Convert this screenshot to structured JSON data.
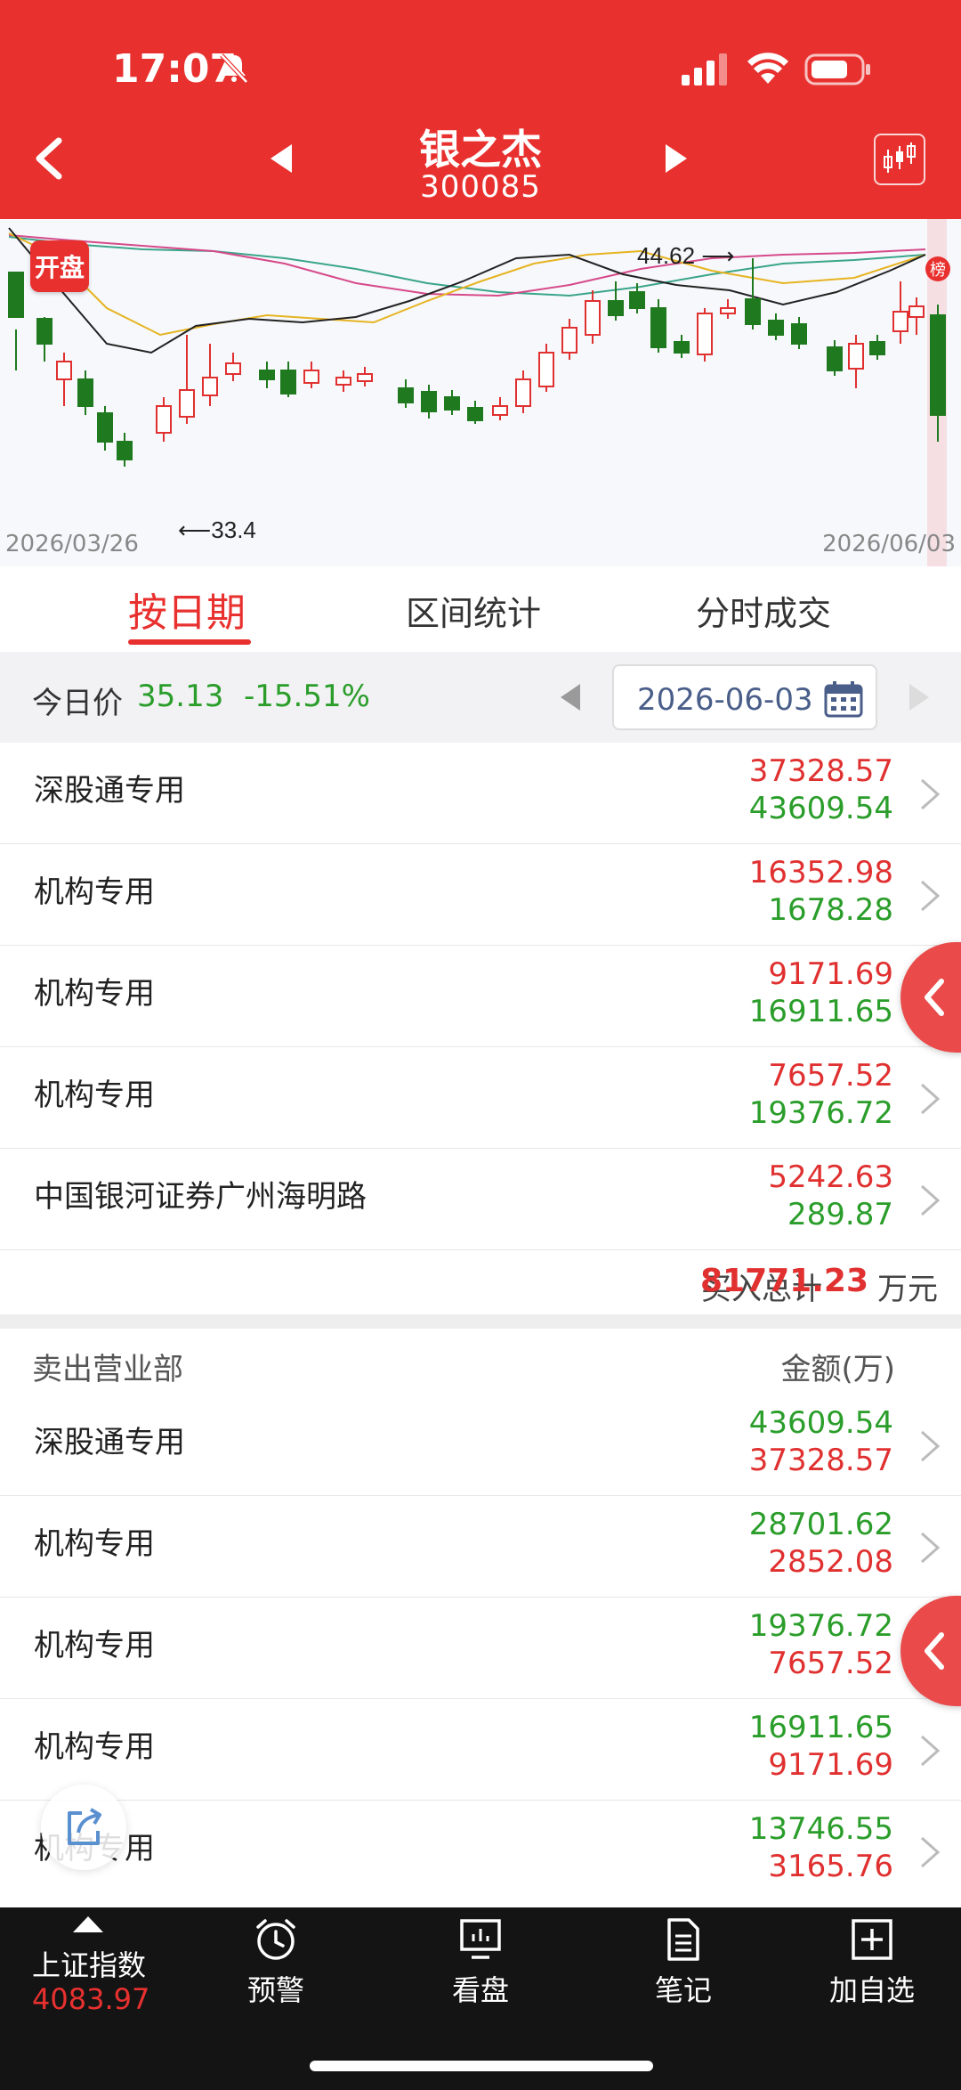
{
  "status_bar": {
    "time": "17:07"
  },
  "header": {
    "stock_name": "银之杰",
    "stock_code": "300085"
  },
  "chart": {
    "badge": "开盘",
    "high_label": "44.62",
    "low_label": "33.4",
    "rank_badge": "榜",
    "start_date": "2026/03/26",
    "end_date": "2026/06/03",
    "colors": {
      "up": "#e03030",
      "down": "#1f7a1f",
      "ma5": "#222222",
      "ma10": "#e6b422",
      "ma20": "#d64a8a",
      "ma30": "#3aa58a"
    }
  },
  "tabs": {
    "by_date": "按日期",
    "range_stats": "区间统计",
    "time_trades": "分时成交"
  },
  "price_row": {
    "label": "今日价",
    "price": "35.13",
    "change": "-15.51%",
    "date": "2026-06-03"
  },
  "buy_rows": [
    {
      "name": "深股通专用",
      "v1": "37328.57",
      "v2": "43609.54"
    },
    {
      "name": "机构专用",
      "v1": "16352.98",
      "v2": "1678.28"
    },
    {
      "name": "机构专用",
      "v1": "9171.69",
      "v2": "16911.65"
    },
    {
      "name": "机构专用",
      "v1": "7657.52",
      "v2": "19376.72"
    },
    {
      "name": "中国银河证券广州海明路",
      "v1": "5242.63",
      "v2": "289.87"
    }
  ],
  "buy_total": {
    "label": "买入总计",
    "value": "81771.23",
    "unit": "万元"
  },
  "sell_header": {
    "title": "卖出营业部",
    "amount": "金额(万)"
  },
  "sell_rows": [
    {
      "name": "深股通专用",
      "v1": "43609.54",
      "v2": "37328.57"
    },
    {
      "name": "机构专用",
      "v1": "28701.62",
      "v2": "2852.08"
    },
    {
      "name": "机构专用",
      "v1": "19376.72",
      "v2": "7657.52"
    },
    {
      "name": "机构专用",
      "v1": "16911.65",
      "v2": "9171.69"
    },
    {
      "name": "机构专用",
      "v1": "13746.55",
      "v2": "3165.76"
    }
  ],
  "bottom_nav": {
    "index_name": "上证指数",
    "index_value": "4083.97",
    "alert": "预警",
    "board": "看盘",
    "notes": "笔记",
    "add_watch": "加自选"
  }
}
